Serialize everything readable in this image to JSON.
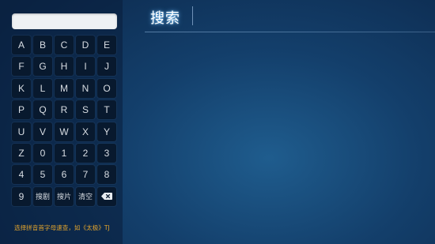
{
  "page": {
    "title": "搜索"
  },
  "search": {
    "query": ""
  },
  "keyboard": {
    "keys": [
      "A",
      "B",
      "C",
      "D",
      "E",
      "F",
      "G",
      "H",
      "I",
      "J",
      "K",
      "L",
      "M",
      "N",
      "O",
      "P",
      "Q",
      "R",
      "S",
      "T",
      "U",
      "V",
      "W",
      "X",
      "Y",
      "Z",
      "0",
      "1",
      "2",
      "3",
      "4",
      "5",
      "6",
      "7",
      "8",
      "9",
      "搜剧",
      "搜片",
      "清空"
    ],
    "backspace_icon": "backspace-icon"
  },
  "hint": {
    "text": "选择拼音首字母速查，如《太极》TJ"
  },
  "colors": {
    "hint": "#e4a52c",
    "key_bg": "#08192e",
    "search_box": "#eef1f4"
  }
}
